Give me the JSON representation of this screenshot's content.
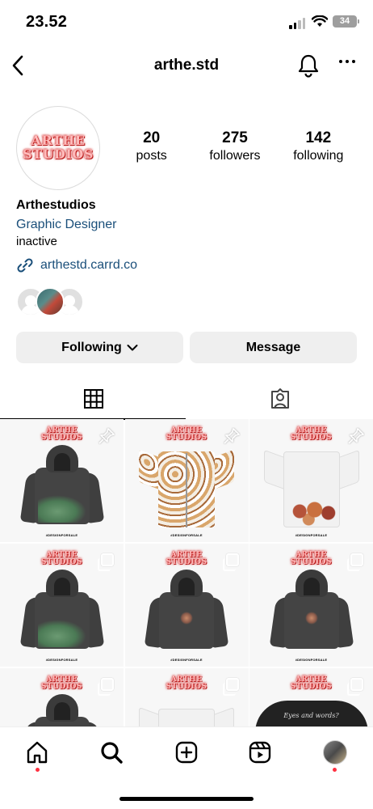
{
  "status": {
    "time": "23.52",
    "battery": "34"
  },
  "header": {
    "username": "arthe.std"
  },
  "profile": {
    "logo_line1": "ARTHE",
    "logo_line2": "STUDIOS",
    "stats": [
      {
        "value": "20",
        "label": "posts"
      },
      {
        "value": "275",
        "label": "followers"
      },
      {
        "value": "142",
        "label": "following"
      }
    ],
    "name": "Arthestudios",
    "category": "Graphic Designer",
    "bio": "inactive",
    "link": "arthestd.carrd.co"
  },
  "buttons": {
    "following": "Following",
    "message": "Message"
  },
  "grid": {
    "logo_line1": "ARTHE",
    "logo_line2": "STUDIOS",
    "tag": "#DESIGNFORSALE",
    "jacket_script": "Eyes and words?"
  },
  "icons": {
    "back": "chevron-left-icon",
    "bell": "bell-icon",
    "more": "more-horizontal-icon",
    "grid": "grid-icon",
    "tagged": "tagged-person-icon",
    "home": "home-icon",
    "search": "search-icon",
    "create": "plus-square-icon",
    "reels": "reels-icon"
  },
  "colors": {
    "link": "#1a4f7a",
    "notification_dot": "#ff3040",
    "button_bg": "#efefef"
  }
}
